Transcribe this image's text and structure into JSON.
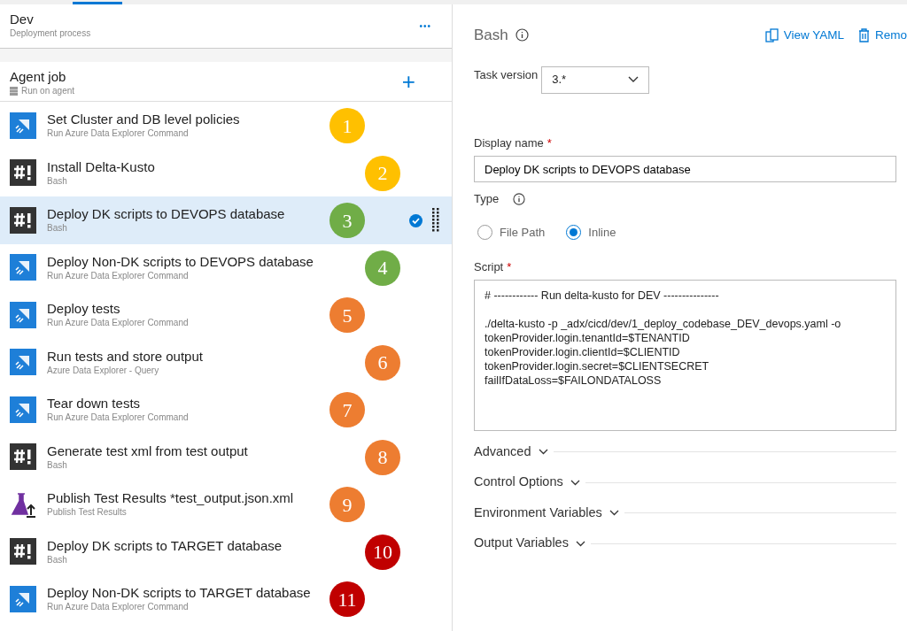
{
  "stage": {
    "title": "Dev",
    "subtitle": "Deployment process",
    "more": "•••"
  },
  "job": {
    "title": "Agent job",
    "subtitle": "Run on agent",
    "add": "+"
  },
  "tasks": [
    {
      "kind": "adx",
      "title": "Set Cluster and DB level policies",
      "subtitle": "Run Azure Data Explorer Command",
      "selected": false,
      "step": "1",
      "color": "#ffc000"
    },
    {
      "kind": "bash",
      "title": "Install Delta-Kusto",
      "subtitle": "Bash",
      "selected": false,
      "step": "2",
      "color": "#ffc000"
    },
    {
      "kind": "bash",
      "title": "Deploy DK scripts to DEVOPS database",
      "subtitle": "Bash",
      "selected": true,
      "step": "3",
      "color": "#70ad47"
    },
    {
      "kind": "adx",
      "title": "Deploy Non-DK scripts to DEVOPS database",
      "subtitle": "Run Azure Data Explorer Command",
      "selected": false,
      "step": "4",
      "color": "#70ad47"
    },
    {
      "kind": "adx",
      "title": "Deploy tests",
      "subtitle": "Run Azure Data Explorer Command",
      "selected": false,
      "step": "5",
      "color": "#ed7d31"
    },
    {
      "kind": "adx",
      "title": "Run tests and store output",
      "subtitle": "Azure Data Explorer - Query",
      "selected": false,
      "step": "6",
      "color": "#ed7d31"
    },
    {
      "kind": "adx",
      "title": "Tear down tests",
      "subtitle": "Run Azure Data Explorer Command",
      "selected": false,
      "step": "7",
      "color": "#ed7d31"
    },
    {
      "kind": "bash",
      "title": "Generate test xml from test output",
      "subtitle": "Bash",
      "selected": false,
      "step": "8",
      "color": "#ed7d31"
    },
    {
      "kind": "publish",
      "title": "Publish Test Results *test_output.json.xml",
      "subtitle": "Publish Test Results",
      "selected": false,
      "step": "9",
      "color": "#ed7d31"
    },
    {
      "kind": "bash",
      "title": "Deploy DK scripts to TARGET database",
      "subtitle": "Bash",
      "selected": false,
      "step": "10",
      "color": "#c00000"
    },
    {
      "kind": "adx",
      "title": "Deploy Non-DK scripts to TARGET database",
      "subtitle": "Run Azure Data Explorer Command",
      "selected": false,
      "step": "11",
      "color": "#c00000"
    }
  ],
  "detail": {
    "title": "Bash",
    "actions": [
      "View YAML",
      "Remo"
    ],
    "task_version": {
      "label": "Task version",
      "value": "3.*"
    },
    "display_name": {
      "label": "Display name",
      "required_mark": "*",
      "value": "Deploy DK scripts to DEVOPS database"
    },
    "type": {
      "label": "Type",
      "options": [
        {
          "label": "File Path",
          "selected": false
        },
        {
          "label": "Inline",
          "selected": true
        }
      ]
    },
    "script": {
      "label": "Script",
      "required_mark": "*",
      "comment": "# ------------ Run delta-kusto for DEV ---------------",
      "lines": [
        "./delta-kusto -p _adx/cicd/dev/1_deploy_codebase_DEV_devops.yaml -o",
        "tokenProvider.login.tenantId=$TENANTID",
        "tokenProvider.login.clientId=$CLIENTID",
        "tokenProvider.login.secret=$CLIENTSECRET",
        "failIfDataLoss=$FAILONDATALOSS"
      ]
    },
    "sections": [
      "Advanced",
      "Control Options",
      "Environment Variables",
      "Output Variables"
    ]
  }
}
